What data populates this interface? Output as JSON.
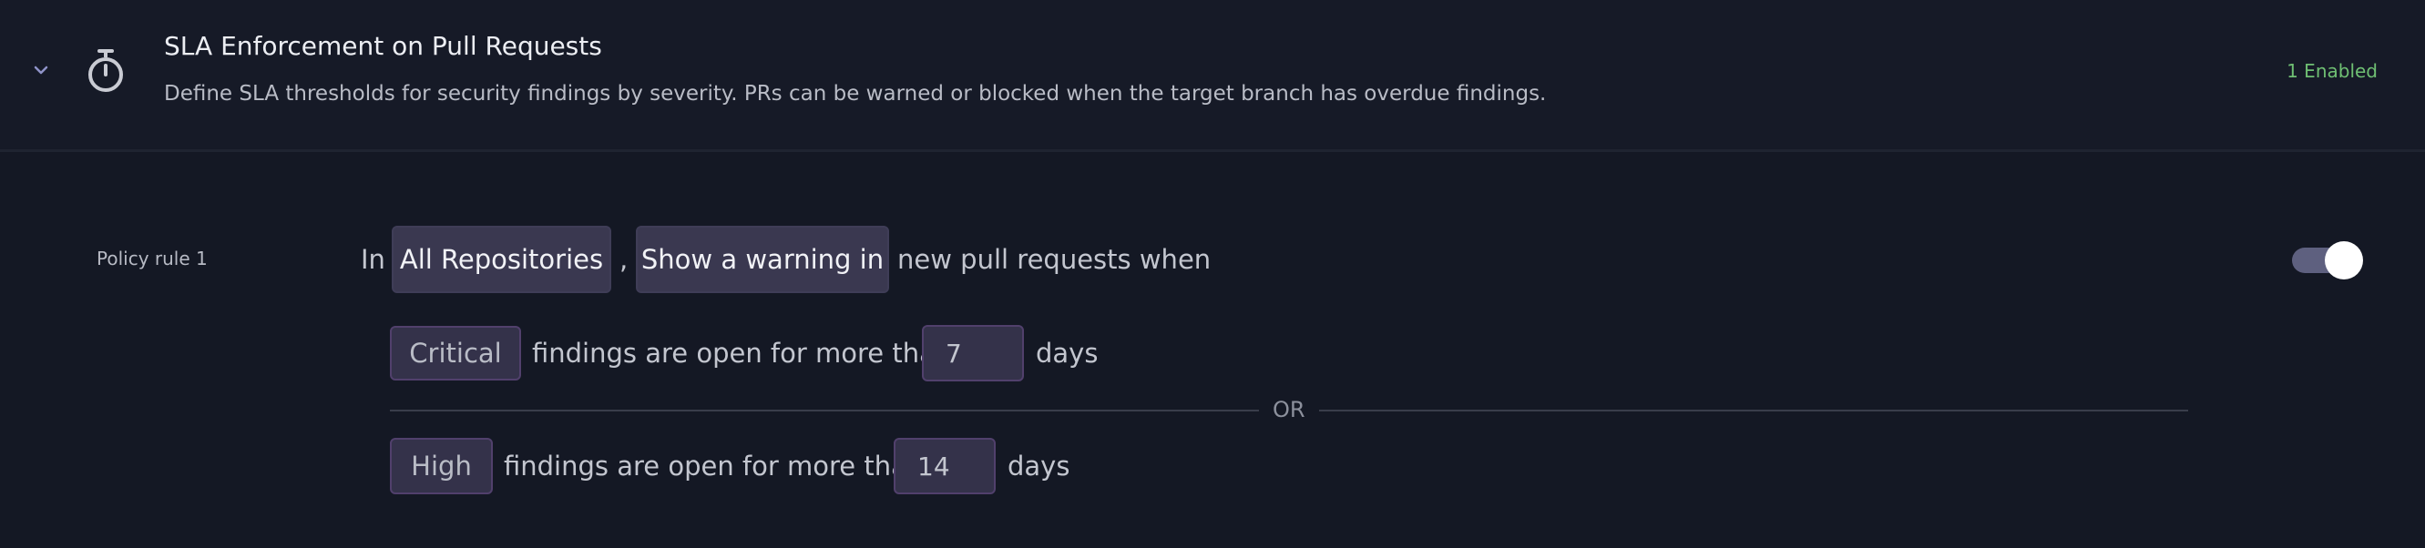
{
  "header": {
    "title": "SLA Enforcement on Pull Requests",
    "description": "Define SLA thresholds for security findings by severity. PRs can be warned or blocked when the target branch has overdue findings.",
    "status": "1 Enabled",
    "icons": {
      "collapse": "chevron-down-icon",
      "section": "stopwatch-icon"
    }
  },
  "rule": {
    "label": "Policy rule 1",
    "sentence": {
      "prefix": "In",
      "repository_scope": "All Repositories",
      "separator": ",",
      "action": "Show a warning in",
      "suffix": "new pull requests when"
    },
    "conditions": [
      {
        "severity": "Critical",
        "text": "findings are open for more than",
        "days": "7",
        "unit": "days"
      },
      {
        "severity": "High",
        "text": "findings are open for more than",
        "days": "14",
        "unit": "days"
      }
    ],
    "conjunction": "OR",
    "enabled": true
  },
  "colors": {
    "background": "#141824",
    "status_green": "#6fbf73",
    "toggle_track": "#5e607f",
    "chip_border": "#51406c"
  }
}
